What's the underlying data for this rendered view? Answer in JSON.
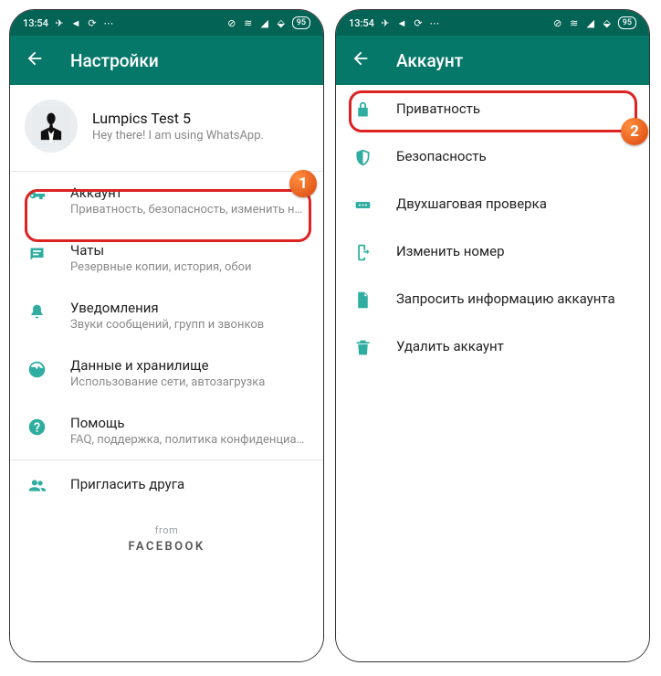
{
  "status": {
    "time": "13:54",
    "battery": "95"
  },
  "left": {
    "title": "Настройки",
    "profile": {
      "name": "Lumpics Test 5",
      "status": "Hey there! I am using WhatsApp."
    },
    "items": [
      {
        "title": "Аккаунт",
        "sub": "Приватность, безопасность, изменить номер"
      },
      {
        "title": "Чаты",
        "sub": "Резервные копии, история, обои"
      },
      {
        "title": "Уведомления",
        "sub": "Звуки сообщений, групп и звонков"
      },
      {
        "title": "Данные и хранилище",
        "sub": "Использование сети, автозагрузка"
      },
      {
        "title": "Помощь",
        "sub": "FAQ, поддержка, политика конфиденциальн..."
      },
      {
        "title": "Пригласить друга",
        "sub": ""
      }
    ],
    "footer": {
      "from": "from",
      "brand": "FACEBOOK"
    }
  },
  "right": {
    "title": "Аккаунт",
    "items": [
      {
        "title": "Приватность"
      },
      {
        "title": "Безопасность"
      },
      {
        "title": "Двухшаговая проверка"
      },
      {
        "title": "Изменить номер"
      },
      {
        "title": "Запросить информацию аккаунта"
      },
      {
        "title": "Удалить аккаунт"
      }
    ]
  },
  "markers": {
    "one": "1",
    "two": "2"
  }
}
